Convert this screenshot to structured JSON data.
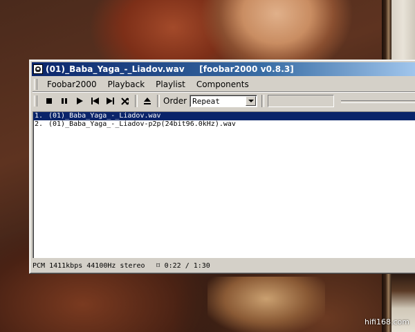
{
  "window": {
    "title": "(01)_Baba_Yaga_-_Liadov.wav     [foobar2000 v0.8.3]"
  },
  "menu": {
    "items": [
      "Foobar2000",
      "Playback",
      "Playlist",
      "Components"
    ]
  },
  "toolbar": {
    "buttons": [
      "stop-icon",
      "pause-icon",
      "play-icon",
      "previous-icon",
      "next-icon",
      "random-icon",
      "eject-icon"
    ],
    "order_label": "Order",
    "order_value": "Repeat"
  },
  "playlist": {
    "selected_index": 0,
    "items": [
      {
        "index": "1.",
        "title": "(01)_Baba_Yaga_-_Liadov.wav"
      },
      {
        "index": "2.",
        "title": "(01)_Baba_Yaga_-_Liadov-p2p(24bit96.0kHz).wav"
      }
    ]
  },
  "status": {
    "info": "PCM 1411kbps 44100Hz stereo",
    "icon": "device-icon",
    "time": "0:22 / 1:30"
  },
  "watermark": "hifi168.com",
  "colors": {
    "title_bar_start": "#0a246a",
    "title_bar_end": "#a6caf0",
    "selection": "#0a246a",
    "face": "#d4d0c8"
  }
}
